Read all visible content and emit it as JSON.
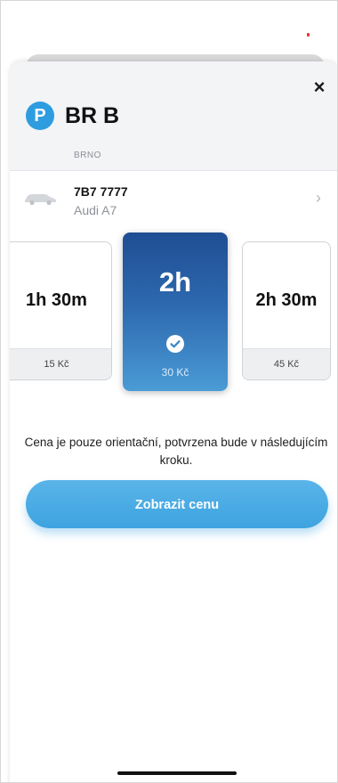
{
  "sheet": {
    "close_label": "×",
    "zone_badge": "P",
    "zone_name": "BR B",
    "zone_city": "BRNO"
  },
  "vehicle": {
    "plate": "7B7 7777",
    "model": "Audi A7",
    "chevron": "›",
    "icon": "car-icon"
  },
  "durations": [
    {
      "label": "1h 30m",
      "price": "15 Kč",
      "selected": false
    },
    {
      "label": "2h",
      "price": "30 Kč",
      "selected": true
    },
    {
      "label": "2h 30m",
      "price": "45 Kč",
      "selected": false
    }
  ],
  "note": "Cena je pouze orientační, potvrzena bude v následujícím kroku.",
  "cta_label": "Zobrazit cenu",
  "colors": {
    "accent": "#3da3e0",
    "badge": "#2d9de0",
    "selected_top": "#1f4e93",
    "selected_bottom": "#4a9bd6",
    "status_dot": "#e23a2e"
  }
}
